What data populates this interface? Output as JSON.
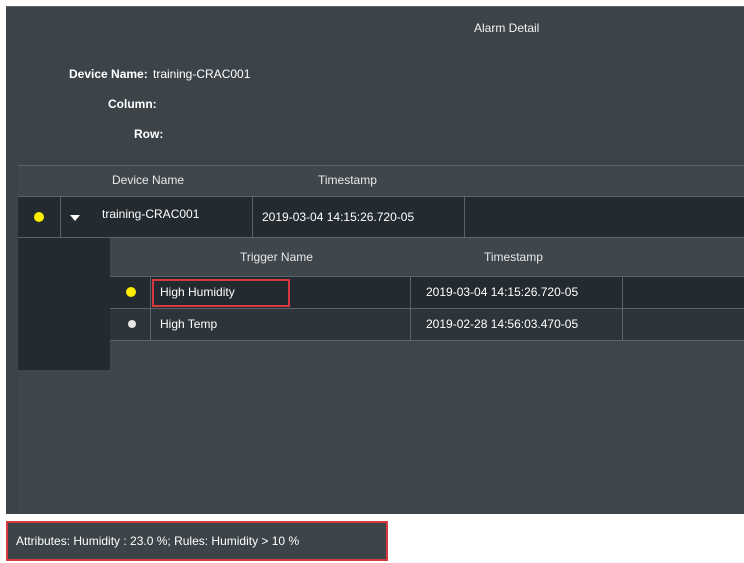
{
  "window": {
    "title": "Alarm Detail"
  },
  "info": {
    "device_name_label": "Device Name:",
    "device_name_value": "training-CRAC001",
    "column_label": "Column:",
    "row_label": "Row:"
  },
  "alarm_table": {
    "headers": [
      "Device Name",
      "Timestamp"
    ],
    "rows": [
      {
        "status_color": "#ffee00",
        "expanded": true,
        "device_name": "training-CRAC001",
        "timestamp": "2019-03-04 14:15:26.720-05"
      }
    ]
  },
  "trigger_table": {
    "headers": [
      "Trigger Name",
      "Timestamp"
    ],
    "rows": [
      {
        "status_color": "#ffee00",
        "trigger_name": "High Humidity",
        "timestamp": "2019-03-04 14:15:26.720-05",
        "selected": true
      },
      {
        "status_color": "#e6e6e6",
        "trigger_name": "High Temp",
        "timestamp": "2019-02-28 14:56:03.470-05",
        "selected": false
      }
    ]
  },
  "status_bar": {
    "text": "Attributes: Humidity : 23.0 %; Rules: Humidity > 10 %"
  },
  "colors": {
    "accent_highlight": "#d8383f",
    "alarm_active": "#ffee00",
    "alarm_inactive": "#e6e6e6"
  }
}
